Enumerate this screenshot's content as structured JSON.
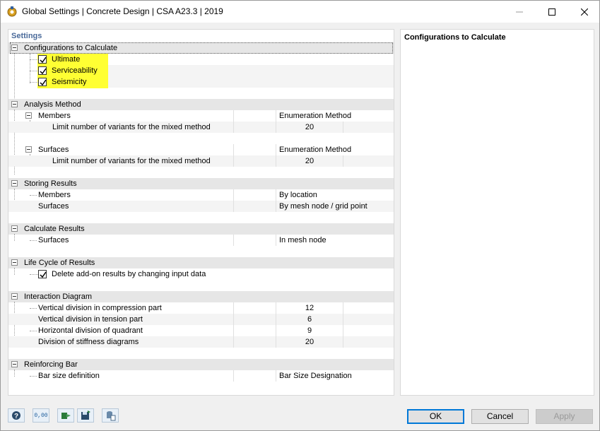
{
  "window": {
    "title": "Global Settings | Concrete Design | CSA A23.3 | 2019"
  },
  "left_panel": {
    "label": "Settings",
    "sections": {
      "configurations": {
        "title": "Configurations to Calculate",
        "items": [
          {
            "label": "Ultimate",
            "checked": true
          },
          {
            "label": "Serviceability",
            "checked": true
          },
          {
            "label": "Seismicity",
            "checked": true
          }
        ]
      },
      "analysis_method": {
        "title": "Analysis Method",
        "members_label": "Members",
        "members_value": "Enumeration Method",
        "members_limit_label": "Limit number of variants for the mixed method",
        "members_limit_value": "20",
        "surfaces_label": "Surfaces",
        "surfaces_value": "Enumeration Method",
        "surfaces_limit_label": "Limit number of variants for the mixed method",
        "surfaces_limit_value": "20"
      },
      "storing_results": {
        "title": "Storing Results",
        "members_label": "Members",
        "members_value": "By location",
        "surfaces_label": "Surfaces",
        "surfaces_value": "By mesh node / grid point"
      },
      "calculate_results": {
        "title": "Calculate Results",
        "surfaces_label": "Surfaces",
        "surfaces_value": "In mesh node"
      },
      "life_cycle": {
        "title": "Life Cycle of Results",
        "delete_label": "Delete add-on results by changing input data",
        "delete_checked": true
      },
      "interaction_diagram": {
        "title": "Interaction Diagram",
        "rows": [
          {
            "label": "Vertical division in compression part",
            "value": "12"
          },
          {
            "label": "Vertical division in tension part",
            "value": "6"
          },
          {
            "label": "Horizontal division of quadrant",
            "value": "9"
          },
          {
            "label": "Division of stiffness diagrams",
            "value": "20"
          }
        ]
      },
      "reinforcing_bar": {
        "title": "Reinforcing Bar",
        "bar_size_label": "Bar size definition",
        "bar_size_value": "Bar Size Designation"
      }
    }
  },
  "right_panel": {
    "title": "Configurations to Calculate"
  },
  "footer": {
    "icons": [
      "help-icon",
      "units-icon",
      "export-icon",
      "save-icon",
      "defaults-icon"
    ],
    "units_icon_text": "0,00",
    "ok_label": "OK",
    "cancel_label": "Cancel",
    "apply_label": "Apply"
  },
  "colors": {
    "highlight": "#ffff33",
    "section_header_bg": "#e6e6e6",
    "ok_border": "#0078d7",
    "settings_label": "#4a6a9a"
  }
}
